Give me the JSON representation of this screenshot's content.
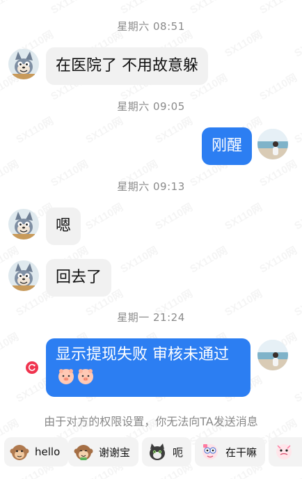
{
  "watermark": "SX110网",
  "messages": [
    {
      "type": "time",
      "text": "星期六 08:51"
    },
    {
      "type": "incoming",
      "text": "在医院了 不用故意躲"
    },
    {
      "type": "time",
      "text": "星期六 09:05"
    },
    {
      "type": "outgoing",
      "text": "刚醒"
    },
    {
      "type": "time",
      "text": "星期六 09:13"
    },
    {
      "type": "incoming",
      "text": "嗯"
    },
    {
      "type": "incoming",
      "text": "回去了"
    },
    {
      "type": "time",
      "text": "星期一 21:24"
    },
    {
      "type": "outgoing",
      "text": "显示提现失败 审核未通过",
      "emojis": [
        "pig-face-emoji",
        "pig-face-emoji"
      ],
      "status": "send-failed"
    }
  ],
  "notice": "由于对方的权限设置，你无法向TA发送消息",
  "quick_replies": [
    {
      "label": "hello",
      "icon": "monkey-sticker-icon"
    },
    {
      "label": "谢谢宝",
      "icon": "monkey-thanks-sticker-icon"
    },
    {
      "label": "呃",
      "icon": "cat-sticker-icon"
    },
    {
      "label": "在干嘛",
      "icon": "cartoon-sticker-icon"
    },
    {
      "label": "",
      "icon": "cartoon-sticker-icon"
    }
  ],
  "colors": {
    "outgoing_bubble": "#2c7ef2",
    "incoming_bubble": "#f1f1f1",
    "failed_status": "#f0344f"
  }
}
